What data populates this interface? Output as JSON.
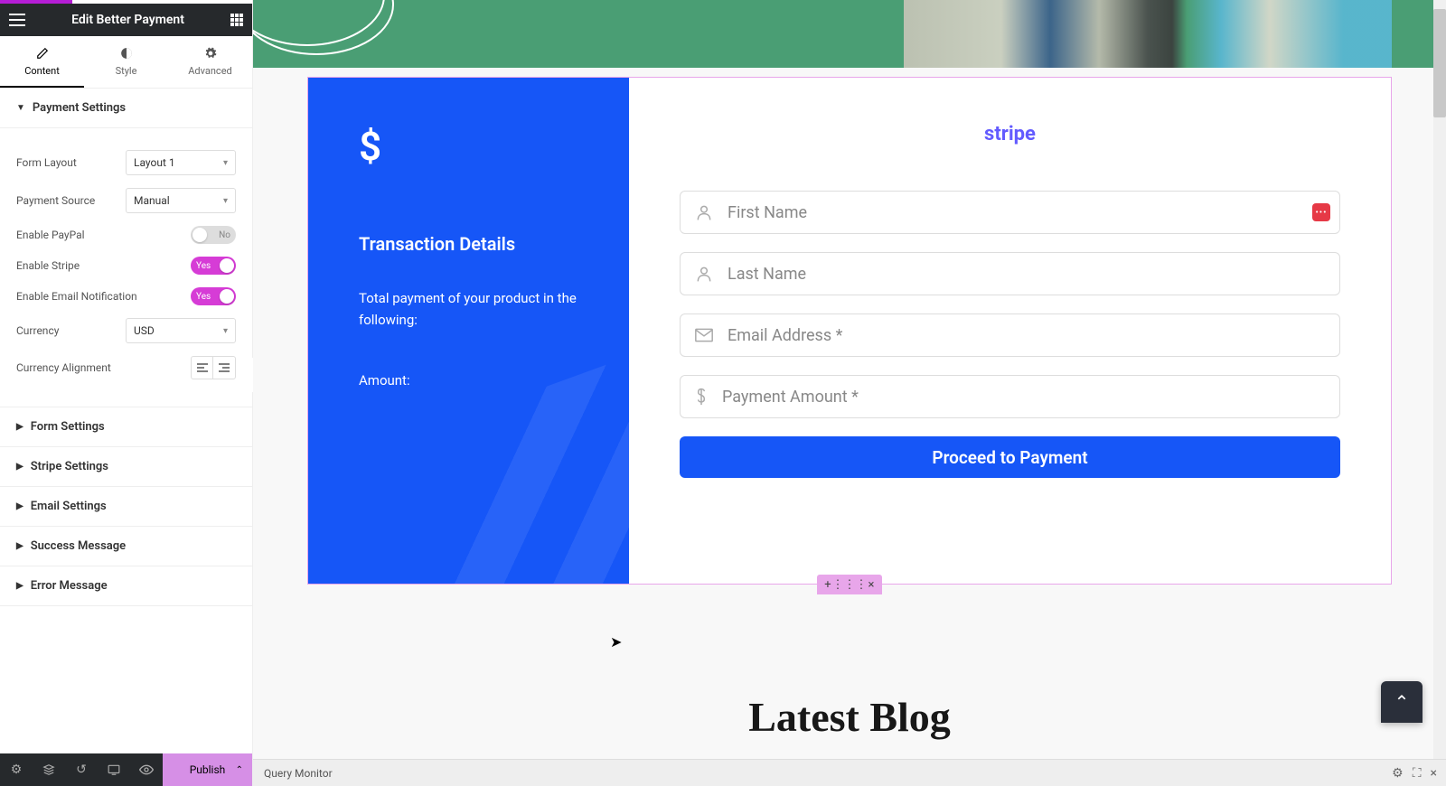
{
  "header": {
    "title": "Edit Better Payment"
  },
  "tabs": {
    "content": "Content",
    "style": "Style",
    "advanced": "Advanced"
  },
  "sections": {
    "payment_settings": "Payment Settings",
    "form_settings": "Form Settings",
    "stripe_settings": "Stripe Settings",
    "email_settings": "Email Settings",
    "success_message": "Success Message",
    "error_message": "Error Message"
  },
  "controls": {
    "form_layout": {
      "label": "Form Layout",
      "value": "Layout 1"
    },
    "payment_source": {
      "label": "Payment Source",
      "value": "Manual"
    },
    "enable_paypal": {
      "label": "Enable PayPal",
      "value": "No"
    },
    "enable_stripe": {
      "label": "Enable Stripe",
      "value": "Yes"
    },
    "enable_email_notif": {
      "label": "Enable Email Notification",
      "value": "Yes"
    },
    "currency": {
      "label": "Currency",
      "value": "USD"
    },
    "currency_alignment": {
      "label": "Currency Alignment"
    }
  },
  "footer": {
    "publish": "Publish"
  },
  "widget": {
    "stripe_logo": "stripe",
    "transaction_title": "Transaction Details",
    "transaction_desc": "Total payment of your product in the following:",
    "amount_label": "Amount:",
    "fields": {
      "first_name": "First Name",
      "last_name": "Last Name",
      "email": "Email Address *",
      "amount": "Payment Amount *"
    },
    "submit": "Proceed to Payment"
  },
  "preview": {
    "latest_blog": "Latest Blog",
    "query_monitor": "Query Monitor"
  }
}
